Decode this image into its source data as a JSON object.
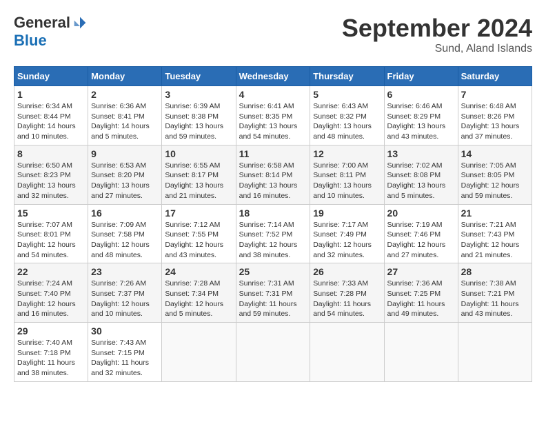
{
  "logo": {
    "general": "General",
    "blue": "Blue"
  },
  "title": "September 2024",
  "subtitle": "Sund, Aland Islands",
  "days_header": [
    "Sunday",
    "Monday",
    "Tuesday",
    "Wednesday",
    "Thursday",
    "Friday",
    "Saturday"
  ],
  "weeks": [
    [
      {
        "day": "1",
        "sunrise": "Sunrise: 6:34 AM",
        "sunset": "Sunset: 8:44 PM",
        "daylight": "Daylight: 14 hours and 10 minutes."
      },
      {
        "day": "2",
        "sunrise": "Sunrise: 6:36 AM",
        "sunset": "Sunset: 8:41 PM",
        "daylight": "Daylight: 14 hours and 5 minutes."
      },
      {
        "day": "3",
        "sunrise": "Sunrise: 6:39 AM",
        "sunset": "Sunset: 8:38 PM",
        "daylight": "Daylight: 13 hours and 59 minutes."
      },
      {
        "day": "4",
        "sunrise": "Sunrise: 6:41 AM",
        "sunset": "Sunset: 8:35 PM",
        "daylight": "Daylight: 13 hours and 54 minutes."
      },
      {
        "day": "5",
        "sunrise": "Sunrise: 6:43 AM",
        "sunset": "Sunset: 8:32 PM",
        "daylight": "Daylight: 13 hours and 48 minutes."
      },
      {
        "day": "6",
        "sunrise": "Sunrise: 6:46 AM",
        "sunset": "Sunset: 8:29 PM",
        "daylight": "Daylight: 13 hours and 43 minutes."
      },
      {
        "day": "7",
        "sunrise": "Sunrise: 6:48 AM",
        "sunset": "Sunset: 8:26 PM",
        "daylight": "Daylight: 13 hours and 37 minutes."
      }
    ],
    [
      {
        "day": "8",
        "sunrise": "Sunrise: 6:50 AM",
        "sunset": "Sunset: 8:23 PM",
        "daylight": "Daylight: 13 hours and 32 minutes."
      },
      {
        "day": "9",
        "sunrise": "Sunrise: 6:53 AM",
        "sunset": "Sunset: 8:20 PM",
        "daylight": "Daylight: 13 hours and 27 minutes."
      },
      {
        "day": "10",
        "sunrise": "Sunrise: 6:55 AM",
        "sunset": "Sunset: 8:17 PM",
        "daylight": "Daylight: 13 hours and 21 minutes."
      },
      {
        "day": "11",
        "sunrise": "Sunrise: 6:58 AM",
        "sunset": "Sunset: 8:14 PM",
        "daylight": "Daylight: 13 hours and 16 minutes."
      },
      {
        "day": "12",
        "sunrise": "Sunrise: 7:00 AM",
        "sunset": "Sunset: 8:11 PM",
        "daylight": "Daylight: 13 hours and 10 minutes."
      },
      {
        "day": "13",
        "sunrise": "Sunrise: 7:02 AM",
        "sunset": "Sunset: 8:08 PM",
        "daylight": "Daylight: 13 hours and 5 minutes."
      },
      {
        "day": "14",
        "sunrise": "Sunrise: 7:05 AM",
        "sunset": "Sunset: 8:05 PM",
        "daylight": "Daylight: 12 hours and 59 minutes."
      }
    ],
    [
      {
        "day": "15",
        "sunrise": "Sunrise: 7:07 AM",
        "sunset": "Sunset: 8:01 PM",
        "daylight": "Daylight: 12 hours and 54 minutes."
      },
      {
        "day": "16",
        "sunrise": "Sunrise: 7:09 AM",
        "sunset": "Sunset: 7:58 PM",
        "daylight": "Daylight: 12 hours and 48 minutes."
      },
      {
        "day": "17",
        "sunrise": "Sunrise: 7:12 AM",
        "sunset": "Sunset: 7:55 PM",
        "daylight": "Daylight: 12 hours and 43 minutes."
      },
      {
        "day": "18",
        "sunrise": "Sunrise: 7:14 AM",
        "sunset": "Sunset: 7:52 PM",
        "daylight": "Daylight: 12 hours and 38 minutes."
      },
      {
        "day": "19",
        "sunrise": "Sunrise: 7:17 AM",
        "sunset": "Sunset: 7:49 PM",
        "daylight": "Daylight: 12 hours and 32 minutes."
      },
      {
        "day": "20",
        "sunrise": "Sunrise: 7:19 AM",
        "sunset": "Sunset: 7:46 PM",
        "daylight": "Daylight: 12 hours and 27 minutes."
      },
      {
        "day": "21",
        "sunrise": "Sunrise: 7:21 AM",
        "sunset": "Sunset: 7:43 PM",
        "daylight": "Daylight: 12 hours and 21 minutes."
      }
    ],
    [
      {
        "day": "22",
        "sunrise": "Sunrise: 7:24 AM",
        "sunset": "Sunset: 7:40 PM",
        "daylight": "Daylight: 12 hours and 16 minutes."
      },
      {
        "day": "23",
        "sunrise": "Sunrise: 7:26 AM",
        "sunset": "Sunset: 7:37 PM",
        "daylight": "Daylight: 12 hours and 10 minutes."
      },
      {
        "day": "24",
        "sunrise": "Sunrise: 7:28 AM",
        "sunset": "Sunset: 7:34 PM",
        "daylight": "Daylight: 12 hours and 5 minutes."
      },
      {
        "day": "25",
        "sunrise": "Sunrise: 7:31 AM",
        "sunset": "Sunset: 7:31 PM",
        "daylight": "Daylight: 11 hours and 59 minutes."
      },
      {
        "day": "26",
        "sunrise": "Sunrise: 7:33 AM",
        "sunset": "Sunset: 7:28 PM",
        "daylight": "Daylight: 11 hours and 54 minutes."
      },
      {
        "day": "27",
        "sunrise": "Sunrise: 7:36 AM",
        "sunset": "Sunset: 7:25 PM",
        "daylight": "Daylight: 11 hours and 49 minutes."
      },
      {
        "day": "28",
        "sunrise": "Sunrise: 7:38 AM",
        "sunset": "Sunset: 7:21 PM",
        "daylight": "Daylight: 11 hours and 43 minutes."
      }
    ],
    [
      {
        "day": "29",
        "sunrise": "Sunrise: 7:40 AM",
        "sunset": "Sunset: 7:18 PM",
        "daylight": "Daylight: 11 hours and 38 minutes."
      },
      {
        "day": "30",
        "sunrise": "Sunrise: 7:43 AM",
        "sunset": "Sunset: 7:15 PM",
        "daylight": "Daylight: 11 hours and 32 minutes."
      },
      null,
      null,
      null,
      null,
      null
    ]
  ]
}
